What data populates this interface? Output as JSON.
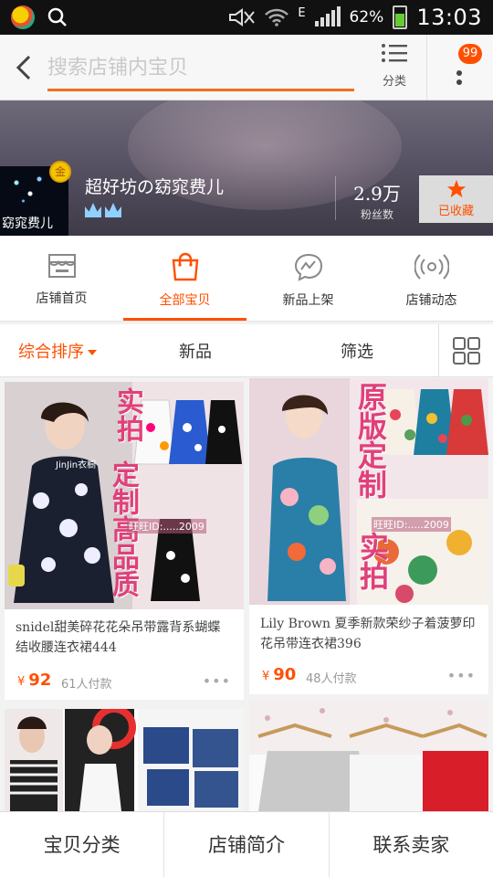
{
  "status_bar": {
    "network_type": "E",
    "battery": "62%",
    "time": "13:03"
  },
  "header": {
    "search_placeholder": "搜索店铺内宝贝",
    "category_label": "分类",
    "badge_count": "99"
  },
  "shop": {
    "logo_text": "窈窕费儿",
    "gold_badge": "金",
    "name": "超好坊の窈窕费儿",
    "fans_count": "2.9万",
    "fans_label": "粉丝数",
    "favorite_label": "已收藏"
  },
  "tabs": [
    {
      "label": "店铺首页",
      "icon": "shop-home-icon",
      "active": false
    },
    {
      "label": "全部宝贝",
      "icon": "shopping-bag-icon",
      "active": true
    },
    {
      "label": "新品上架",
      "icon": "new-arrival-icon",
      "active": false
    },
    {
      "label": "店铺动态",
      "icon": "broadcast-icon",
      "active": false
    }
  ],
  "sort_bar": {
    "items": [
      "综合排序",
      "新品",
      "筛选"
    ]
  },
  "products": [
    {
      "title": "snidel甜美碎花花朵吊带露背系蝴蝶结收腰连衣裙444",
      "currency": "¥",
      "price": "92",
      "sold": "61人付款",
      "overlay_text_1": "实拍",
      "overlay_text_2": "定制高品质",
      "watermark": "旺旺ID:.....2009",
      "brand_watermark": "JinJin衣橱"
    },
    {
      "title": "Lily Brown 夏季新款荣纱子着菠萝印花吊带连衣裙396",
      "currency": "¥",
      "price": "90",
      "sold": "48人付款",
      "overlay_text_1": "原版定制",
      "overlay_text_2": "实拍",
      "watermark": "旺旺ID:.....2009"
    }
  ],
  "bottom_nav": {
    "items": [
      "宝贝分类",
      "店铺简介",
      "联系卖家"
    ]
  },
  "colors": {
    "accent": "#ff5000",
    "overlay_pink": "#e0407a"
  }
}
